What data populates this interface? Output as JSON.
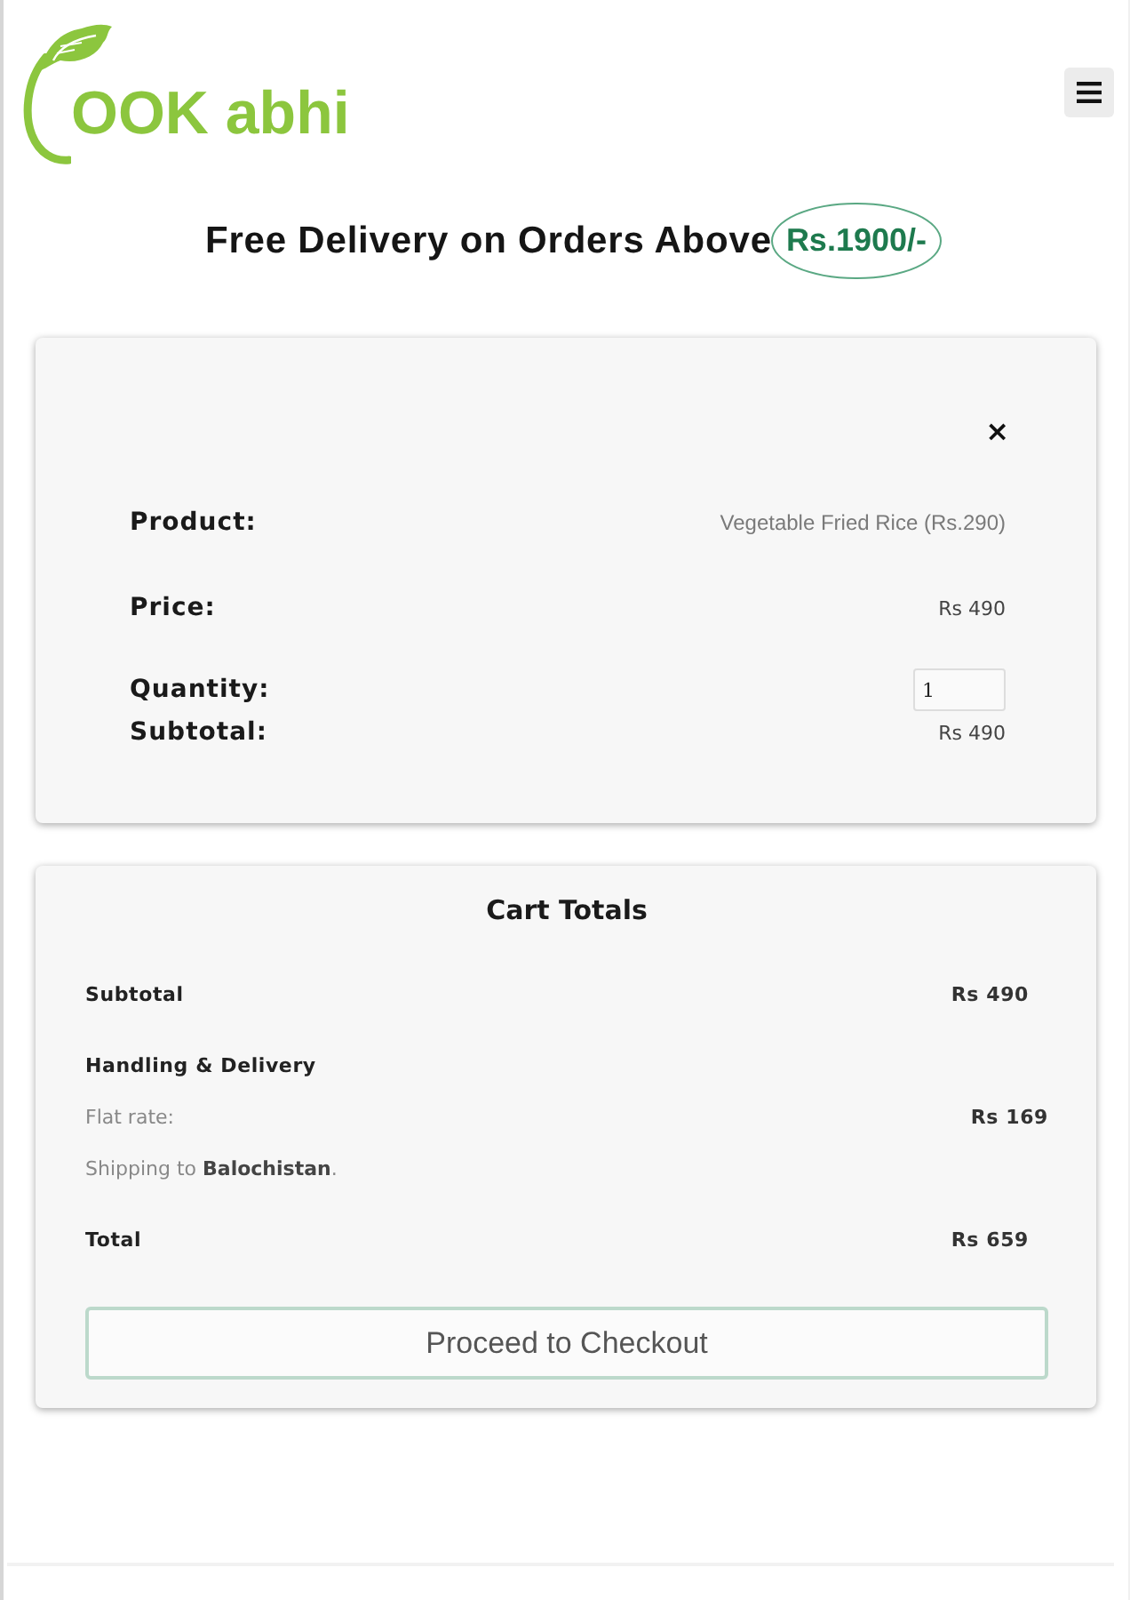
{
  "header": {
    "logo": {
      "text": "OOK abhi"
    }
  },
  "promo": {
    "text": "Free Delivery on Orders Above",
    "amount": "Rs.1900/-"
  },
  "cart_item": {
    "remove": "×",
    "rows": [
      {
        "kind": "text",
        "label": "Product:",
        "value": "Vegetable Fried Rice (Rs.290)"
      },
      {
        "kind": "amount",
        "label": "Price:",
        "value": "Rs 490"
      },
      {
        "kind": "input",
        "label": "Quantity:",
        "value": "1"
      },
      {
        "kind": "amount",
        "label": "Subtotal:",
        "value": "Rs 490"
      }
    ]
  },
  "cart_totals": {
    "title": "Cart Totals",
    "rows": [
      {
        "kind": "amount",
        "label": "Subtotal",
        "value": "Rs 490"
      },
      {
        "kind": "heading",
        "label": "Handling & Delivery"
      },
      {
        "kind": "rate",
        "label": "Flat rate:",
        "value": "Rs 169"
      },
      {
        "kind": "note",
        "text": "Shipping to **Balochistan**."
      },
      {
        "kind": "amount",
        "label": "Total",
        "value": "Rs 659"
      }
    ],
    "checkout_button": "Proceed to Checkout"
  }
}
